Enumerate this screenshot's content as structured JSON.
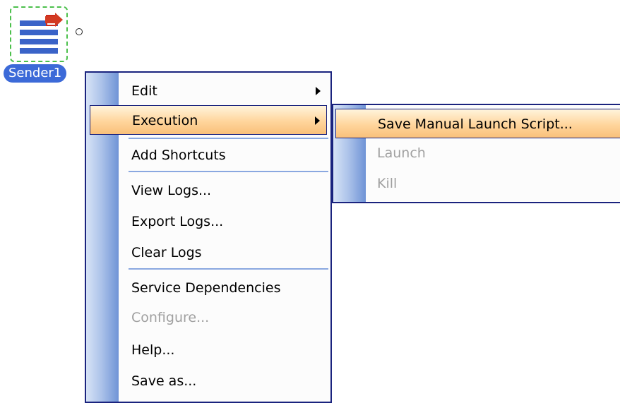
{
  "node": {
    "label": "Sender1",
    "icon": "sender-icon"
  },
  "context_menu": {
    "items": [
      {
        "label": "Edit",
        "has_submenu": true,
        "enabled": true
      },
      {
        "label": "Execution",
        "has_submenu": true,
        "enabled": true,
        "highlighted": true
      },
      {
        "label": "Add Shortcuts",
        "enabled": true
      },
      {
        "label": "View Logs...",
        "enabled": true
      },
      {
        "label": "Export Logs...",
        "enabled": true
      },
      {
        "label": "Clear Logs",
        "enabled": true
      },
      {
        "label": "Service Dependencies",
        "enabled": true
      },
      {
        "label": "Configure...",
        "enabled": false
      },
      {
        "label": "Help...",
        "enabled": true
      },
      {
        "label": "Save as...",
        "enabled": true
      }
    ]
  },
  "execution_submenu": {
    "items": [
      {
        "label": "Save Manual Launch Script...",
        "enabled": true,
        "highlighted": true
      },
      {
        "label": "Launch",
        "enabled": false
      },
      {
        "label": "Kill",
        "enabled": false
      }
    ]
  },
  "colors": {
    "menu_border": "#1a237e",
    "highlight": "#ffd59c",
    "label_badge": "#3c6ad8",
    "node_border": "#4cc04c"
  }
}
